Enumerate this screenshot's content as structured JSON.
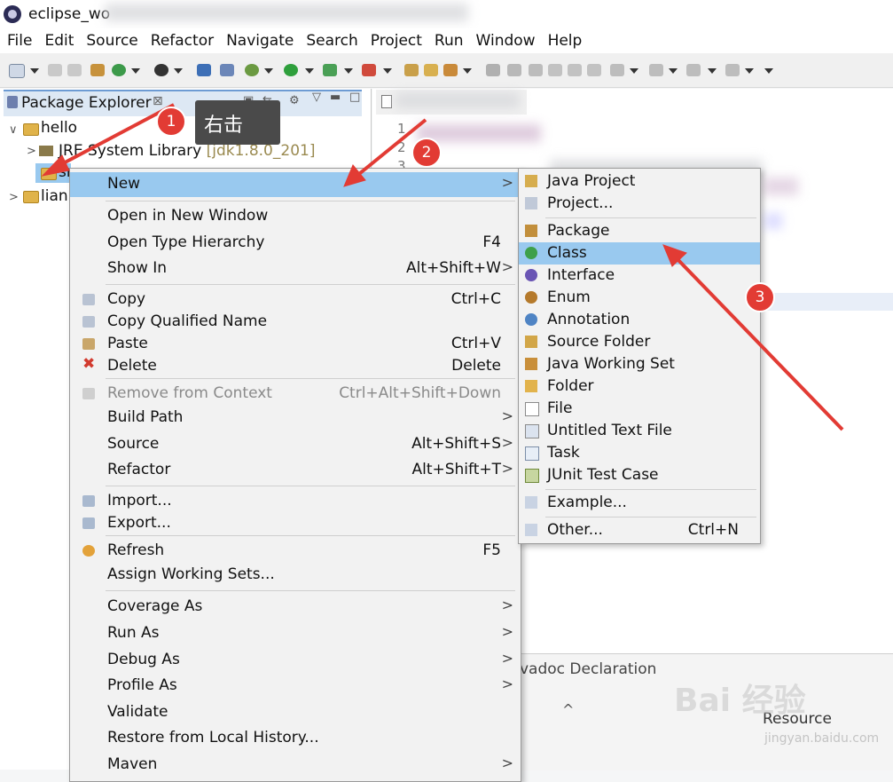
{
  "window": {
    "title": "eclipse_wo"
  },
  "menubar": [
    "File",
    "Edit",
    "Source",
    "Refactor",
    "Navigate",
    "Search",
    "Project",
    "Run",
    "Window",
    "Help"
  ],
  "package_explorer": {
    "title": "Package Explorer",
    "tree": [
      {
        "label": "hello",
        "expanded": true
      },
      {
        "label": "JRE System Library",
        "suffix": "[jdk1.8.0_201]"
      },
      {
        "label": "src"
      },
      {
        "label": "lian"
      }
    ]
  },
  "editor": {
    "line_numbers": [
      "1",
      "2",
      "3"
    ]
  },
  "bottom_panel": {
    "tabs": "vadoc  Declaration",
    "resource": "Resource"
  },
  "context_menu": {
    "items": [
      {
        "label": "New",
        "accel": "",
        "submenu": true,
        "highlighted": true
      },
      {
        "label": "Open in New Window",
        "accel": ""
      },
      {
        "label": "Open Type Hierarchy",
        "accel": "F4"
      },
      {
        "label": "Show In",
        "accel": "Alt+Shift+W",
        "submenu": true
      },
      {
        "label": "Copy",
        "accel": "Ctrl+C",
        "icon": "copy-icon"
      },
      {
        "label": "Copy Qualified Name",
        "accel": "",
        "icon": "copy-qualified-icon"
      },
      {
        "label": "Paste",
        "accel": "Ctrl+V",
        "icon": "paste-icon"
      },
      {
        "label": "Delete",
        "accel": "Delete",
        "icon": "delete-icon"
      },
      {
        "label": "Remove from Context",
        "accel": "Ctrl+Alt+Shift+Down",
        "disabled": true
      },
      {
        "label": "Build Path",
        "accel": "",
        "submenu": true
      },
      {
        "label": "Source",
        "accel": "Alt+Shift+S",
        "submenu": true
      },
      {
        "label": "Refactor",
        "accel": "Alt+Shift+T",
        "submenu": true
      },
      {
        "label": "Import...",
        "accel": "",
        "icon": "import-icon"
      },
      {
        "label": "Export...",
        "accel": "",
        "icon": "export-icon"
      },
      {
        "label": "Refresh",
        "accel": "F5",
        "icon": "refresh-icon"
      },
      {
        "label": "Assign Working Sets...",
        "accel": ""
      },
      {
        "label": "Coverage As",
        "accel": "",
        "submenu": true
      },
      {
        "label": "Run As",
        "accel": "",
        "submenu": true
      },
      {
        "label": "Debug As",
        "accel": "",
        "submenu": true
      },
      {
        "label": "Profile As",
        "accel": "",
        "submenu": true
      },
      {
        "label": "Validate",
        "accel": ""
      },
      {
        "label": "Restore from Local History...",
        "accel": ""
      },
      {
        "label": "Maven",
        "accel": "",
        "submenu": true
      }
    ]
  },
  "new_submenu": {
    "items": [
      {
        "label": "Java Project",
        "accel": "",
        "icon": "java-project-icon"
      },
      {
        "label": "Project...",
        "accel": "",
        "icon": "project-icon"
      },
      {
        "label": "Package",
        "accel": "",
        "icon": "package-icon"
      },
      {
        "label": "Class",
        "accel": "",
        "icon": "class-icon",
        "highlighted": true
      },
      {
        "label": "Interface",
        "accel": "",
        "icon": "interface-icon"
      },
      {
        "label": "Enum",
        "accel": "",
        "icon": "enum-icon"
      },
      {
        "label": "Annotation",
        "accel": "",
        "icon": "annotation-icon"
      },
      {
        "label": "Source Folder",
        "accel": "",
        "icon": "source-folder-icon"
      },
      {
        "label": "Java Working Set",
        "accel": "",
        "icon": "working-set-icon"
      },
      {
        "label": "Folder",
        "accel": "",
        "icon": "folder-icon"
      },
      {
        "label": "File",
        "accel": "",
        "icon": "file-icon"
      },
      {
        "label": "Untitled Text File",
        "accel": "",
        "icon": "text-file-icon"
      },
      {
        "label": "Task",
        "accel": "",
        "icon": "task-icon"
      },
      {
        "label": "JUnit Test Case",
        "accel": "",
        "icon": "junit-icon"
      },
      {
        "label": "Example...",
        "accel": "",
        "icon": "example-icon"
      },
      {
        "label": "Other...",
        "accel": "Ctrl+N",
        "icon": "other-icon"
      }
    ]
  },
  "annotations": {
    "step1": "1",
    "step1_tip": "右击",
    "step2": "2",
    "step3": "3",
    "arrow_color": "#e23b34"
  },
  "watermark": {
    "brand": "Bai 经验",
    "url": "jingyan.baidu.com"
  }
}
